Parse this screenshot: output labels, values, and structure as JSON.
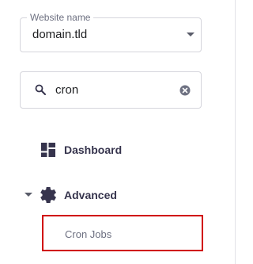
{
  "website_select": {
    "label": "Website name",
    "value": "domain.tld"
  },
  "search": {
    "value": "cron",
    "placeholder": "Search"
  },
  "nav": {
    "dashboard": {
      "label": "Dashboard",
      "icon": "dashboard-icon"
    },
    "advanced": {
      "label": "Advanced",
      "icon": "gear-icon",
      "expanded": true,
      "children": [
        {
          "label": "Cron Jobs"
        }
      ]
    }
  },
  "colors": {
    "highlight_border": "#d00000",
    "nav_text": "#36344d",
    "muted_text": "#6d7081",
    "field_border": "#d5d5dc"
  }
}
